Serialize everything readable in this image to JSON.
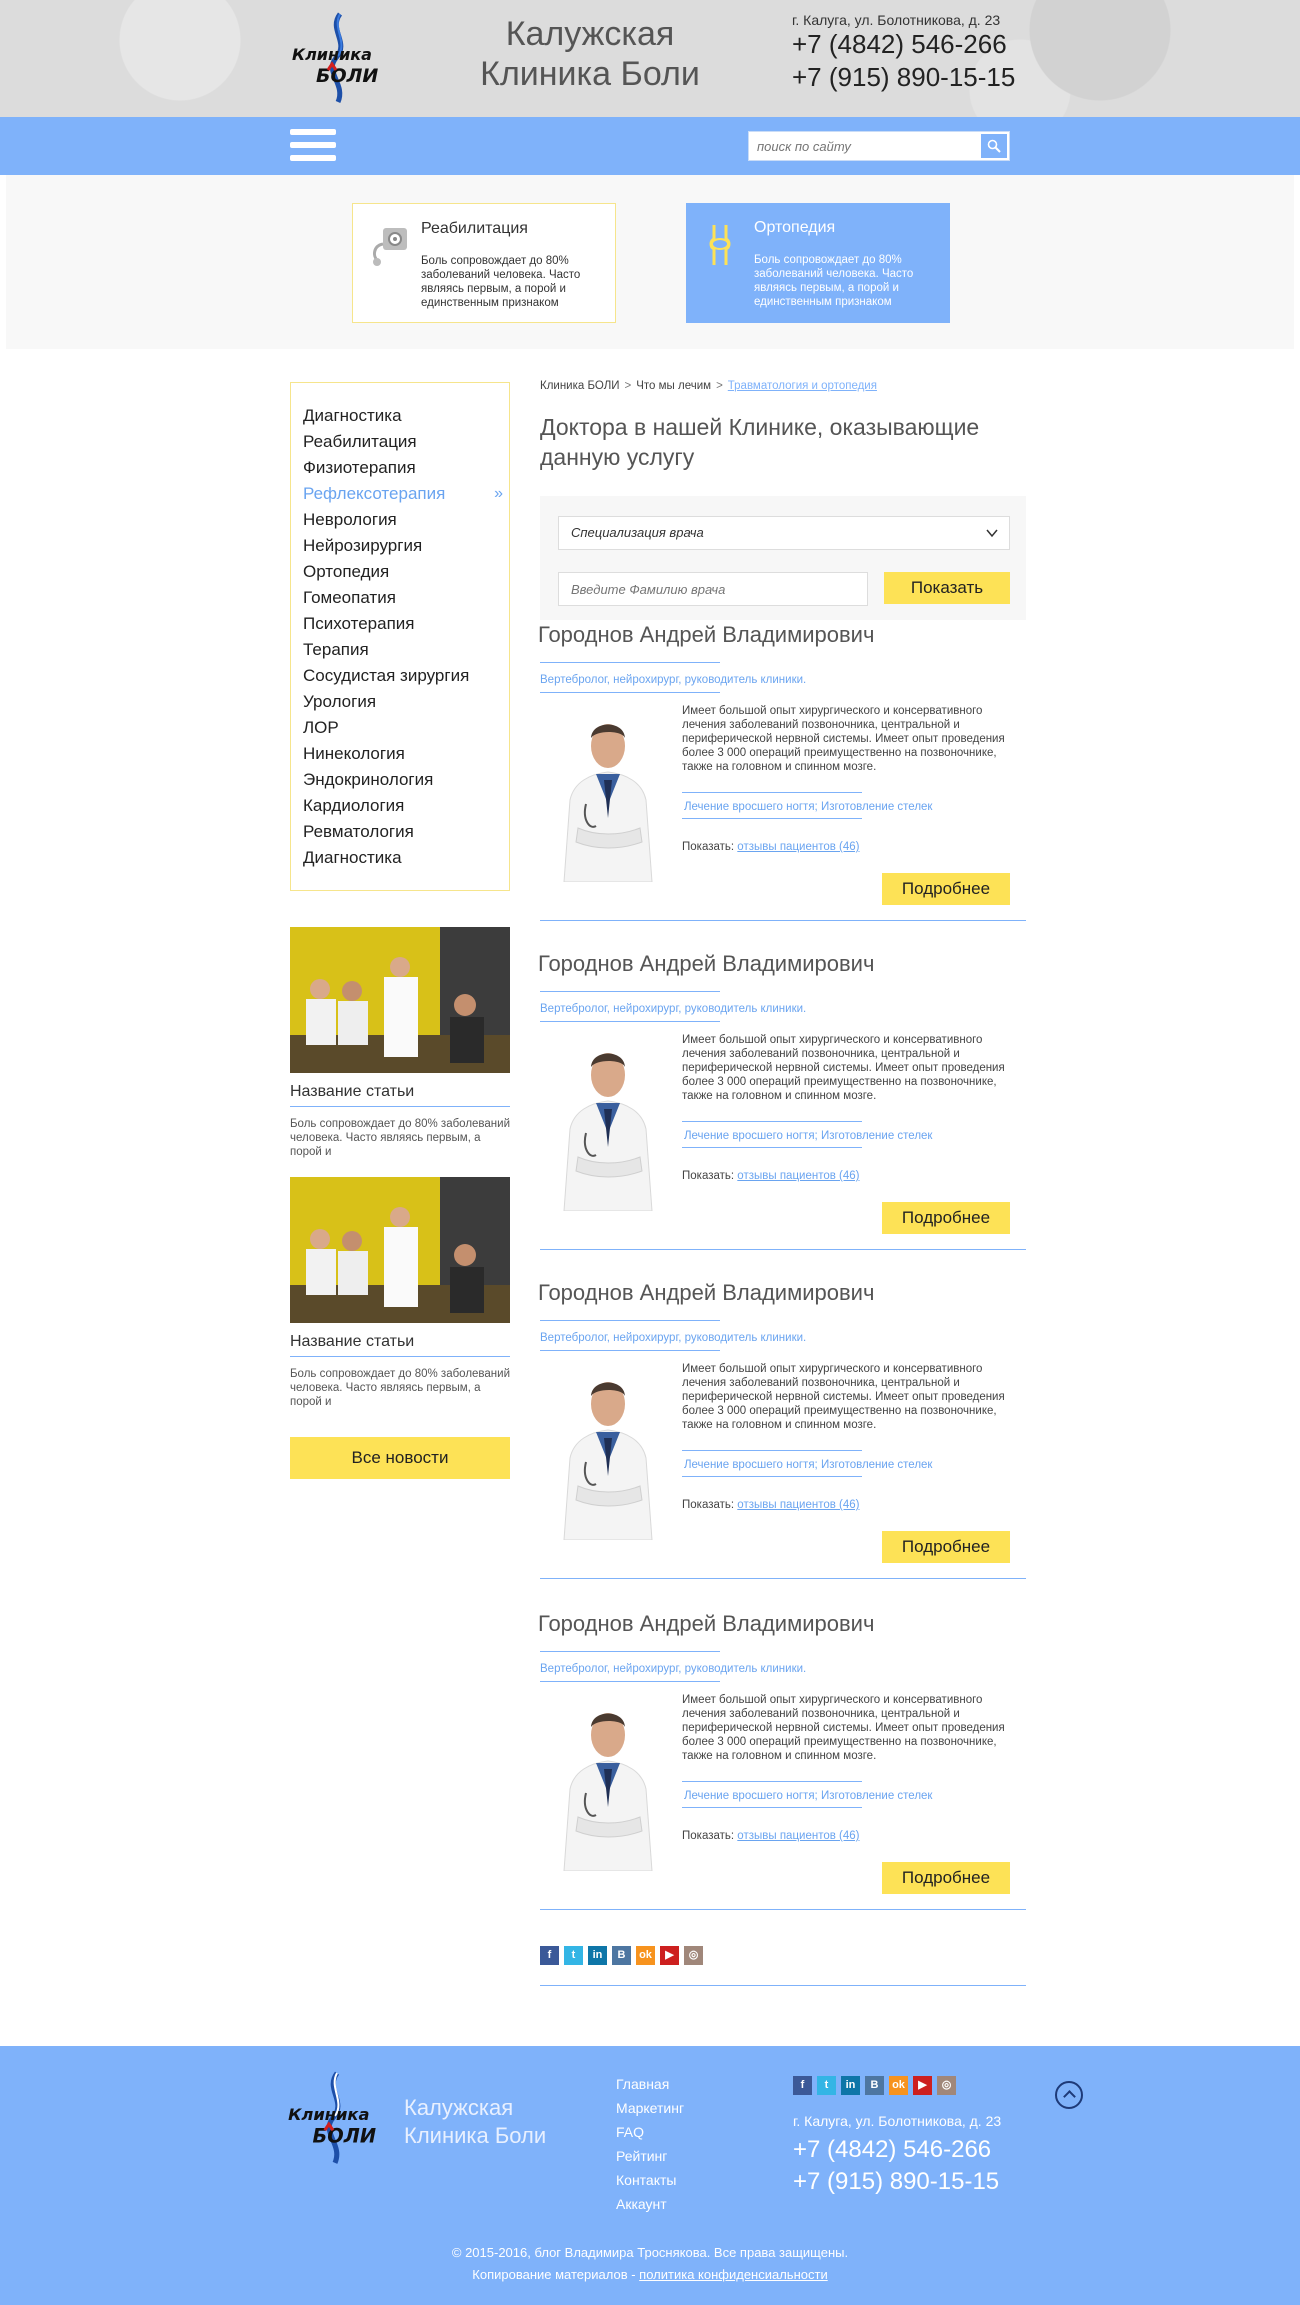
{
  "header": {
    "logo_text": "Клиника БОЛИ",
    "title_line1": "Калужская",
    "title_line2": "Клиника Боли",
    "address": "г. Калуга, ул. Болотникова, д. 23",
    "phone1": "+7 (4842) 546-266",
    "phone2": "+7 (915) 890-15-15"
  },
  "nav": {
    "search_placeholder": "поиск по сайту",
    "menu_icon": "hamburger-icon",
    "search_icon": "search-icon"
  },
  "services": [
    {
      "title": "Реабилитация",
      "text": "Боль сопровождает до 80% заболеваний человека. Часто являясь первым, а порой и единственным признаком",
      "icon": "tonometer-icon"
    },
    {
      "title": "Ортопедия",
      "text": "Боль сопровождает до 80% заболеваний человека. Часто являясь первым, а порой и единственным признаком",
      "icon": "joint-icon"
    }
  ],
  "sidebar": {
    "menu": [
      "Диагностика",
      "Реабилитация",
      "Физиотерапия",
      "Рефлексотерапия",
      "Неврология",
      "Нейрозирургия",
      "Ортопедия",
      "Гомеопатия",
      "Психотерапия",
      "Терапия",
      "Сосудистая зирургия",
      "Урология",
      "ЛОР",
      "Нинекология",
      "Эндокринология",
      "Кардиология",
      "Ревматология",
      "Диагностика"
    ],
    "active_index": 3,
    "articles": [
      {
        "title": "Название статьи",
        "text": "Боль сопровождает до 80% заболеваний человека. Часто являясь первым, а порой и"
      },
      {
        "title": "Название статьи",
        "text": "Боль сопровождает до 80% заболеваний человека. Часто являясь первым, а порой и"
      }
    ],
    "all_news_label": "Все новости"
  },
  "main": {
    "breadcrumb": [
      "Клиника БОЛИ",
      "Что мы лечим",
      "Травматология и ортопедия"
    ],
    "breadcrumb_sep": ">",
    "title": "Доктора в нашей Клинике, оказывающие данную услугу",
    "filter": {
      "select_value": "Специализация врача",
      "name_placeholder": "Введите Фамилию врача",
      "show_label": "Показать"
    },
    "doctors": [
      {
        "name": "Городнов Андрей Владимирович",
        "spec": "Вертебролог, нейрохирург, руководитель клиники.",
        "desc": "Имеет большой опыт хирургического и консервативного лечения заболеваний позвоночника, центральной и периферической нервной системы. Имеет опыт проведения более 3 000 операций преимущественно на позвоночнике, также на головном и спинном мозге.",
        "tags": "Лечение вросшего ногтя; Изготовление стелек",
        "reviews_prefix": "Показать:",
        "reviews_link": "отзывы пациентов (46)",
        "more_label": "Подробнее"
      },
      {
        "name": "Городнов Андрей Владимирович",
        "spec": "Вертебролог, нейрохирург, руководитель клиники.",
        "desc": "Имеет большой опыт хирургического и консервативного лечения заболеваний позвоночника, центральной и периферической нервной системы. Имеет опыт проведения более 3 000 операций преимущественно на позвоночнике, также на головном и спинном мозге.",
        "tags": "Лечение вросшего ногтя; Изготовление стелек",
        "reviews_prefix": "Показать:",
        "reviews_link": "отзывы пациентов (46)",
        "more_label": "Подробнее"
      },
      {
        "name": "Городнов Андрей Владимирович",
        "spec": "Вертебролог, нейрохирург, руководитель клиники.",
        "desc": "Имеет большой опыт хирургического и консервативного лечения заболеваний позвоночника, центральной и периферической нервной системы. Имеет опыт проведения более 3 000 операций преимущественно на позвоночнике, также на головном и спинном мозге.",
        "tags": "Лечение вросшего ногтя; Изготовление стелек",
        "reviews_prefix": "Показать:",
        "reviews_link": "отзывы пациентов (46)",
        "more_label": "Подробнее"
      },
      {
        "name": "Городнов Андрей Владимирович",
        "spec": "Вертебролог, нейрохирург, руководитель клиники.",
        "desc": "Имеет большой опыт хирургического и консервативного лечения заболеваний позвоночника, центральной и периферической нервной системы. Имеет опыт проведения более 3 000 операций преимущественно на позвоночнике, также на головном и спинном мозге.",
        "tags": "Лечение вросшего ногтя; Изготовление стелек",
        "reviews_prefix": "Показать:",
        "reviews_link": "отзывы пациентов (46)",
        "more_label": "Подробнее"
      }
    ]
  },
  "social": [
    {
      "name": "facebook-icon",
      "glyph": "f",
      "color": "#3b5998"
    },
    {
      "name": "twitter-icon",
      "glyph": "t",
      "color": "#33b5e5"
    },
    {
      "name": "linkedin-icon",
      "glyph": "in",
      "color": "#0e76a8"
    },
    {
      "name": "vk-icon",
      "glyph": "B",
      "color": "#4d76a1"
    },
    {
      "name": "odnoklassniki-icon",
      "glyph": "ok",
      "color": "#f7931e"
    },
    {
      "name": "youtube-icon",
      "glyph": "▶",
      "color": "#cd201f"
    },
    {
      "name": "instagram-icon",
      "glyph": "◎",
      "color": "#a0877a"
    }
  ],
  "footer": {
    "title_line1": "Калужская",
    "title_line2": "Клиника Боли",
    "links": [
      "Главная",
      "Маркетинг",
      "FAQ",
      "Рейтинг",
      "Контакты",
      "Аккаунт"
    ],
    "address": "г. Калуга, ул. Болотникова, д. 23",
    "phone1": "+7 (4842) 546-266",
    "phone2": "+7 (915) 890-15-15",
    "copyright": "© 2015-2016, блог Владимира Троснякова. Все права защищены.",
    "copy_note": "Копирование материалов - ",
    "policy_link": "политика конфиденсиальности"
  },
  "colors": {
    "accent": "#7fb2fa",
    "yellow": "#fde256",
    "border_yellow": "#f6e58c"
  }
}
